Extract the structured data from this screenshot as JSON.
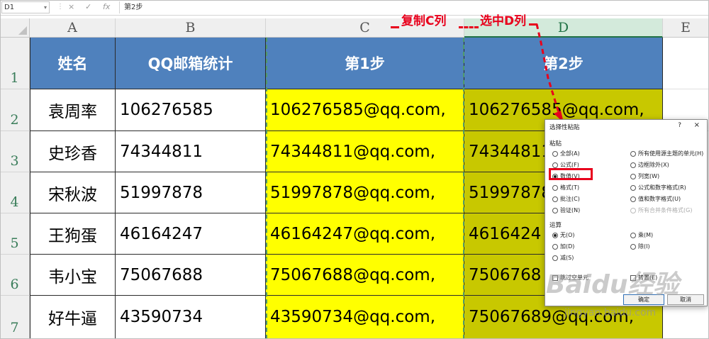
{
  "formula_bar": {
    "name_box": "D1",
    "cancel_icon": "×",
    "confirm_icon": "✓",
    "function_icon": "fx",
    "content": "第2步"
  },
  "columns": [
    "A",
    "B",
    "C",
    "D",
    "E"
  ],
  "rows": [
    "1",
    "2",
    "3",
    "4",
    "5",
    "6",
    "7"
  ],
  "table": {
    "headers": [
      "姓名",
      "QQ邮箱统计",
      "第1步",
      "第2步"
    ],
    "rows": [
      {
        "name": "袁周率",
        "qq": "106276585",
        "step1": "106276585@qq.com,",
        "step2": "106276585@qq.com,"
      },
      {
        "name": "史珍香",
        "qq": "74344811",
        "step1": "74344811@qq.com,",
        "step2": "74344811"
      },
      {
        "name": "宋秋波",
        "qq": "51997878",
        "step1": "51997878@qq.com,",
        "step2": "51997878"
      },
      {
        "name": "王狗蛋",
        "qq": "46164247",
        "step1": "46164247@qq.com,",
        "step2": "4616424"
      },
      {
        "name": "韦小宝",
        "qq": "75067688",
        "step1": "75067688@qq.com,",
        "step2": "7506768"
      },
      {
        "name": "好牛逼",
        "qq": "43590734",
        "step1": "43590734@qq.com,",
        "step2": "75067689@qq.com,"
      }
    ]
  },
  "annotations": {
    "copy_c": "复制C列",
    "select_d": "选中D列"
  },
  "dialog": {
    "title": "选择性粘贴",
    "help": "?",
    "close": "×",
    "paste_section": "粘贴",
    "paste_left": [
      "全部(A)",
      "公式(F)",
      "数值(V)",
      "格式(T)",
      "批注(C)",
      "验证(N)"
    ],
    "paste_right": [
      "所有使用源主题的单元(H)",
      "边框除外(X)",
      "列宽(W)",
      "公式和数字格式(R)",
      "值和数字格式(U)",
      "所有合并条件格式(G)"
    ],
    "selected_paste": "数值(V)",
    "operation_section": "运算",
    "op_left": [
      "无(O)",
      "加(D)",
      "减(S)"
    ],
    "op_right": [
      "乘(M)",
      "除(I)"
    ],
    "selected_op": "无(O)",
    "skip_blanks": "跳过空单元",
    "transpose": "转置(E)",
    "ok": "确定",
    "cancel": "取消"
  },
  "watermark": {
    "logo": "Baidu经验",
    "url": "jingyan.baidu.com"
  },
  "colors": {
    "header_blue": "#4f81bd",
    "yellow": "#ffff00",
    "olive": "#c8c800",
    "annotation_red": "#e8001c",
    "selection_green": "#217346"
  }
}
